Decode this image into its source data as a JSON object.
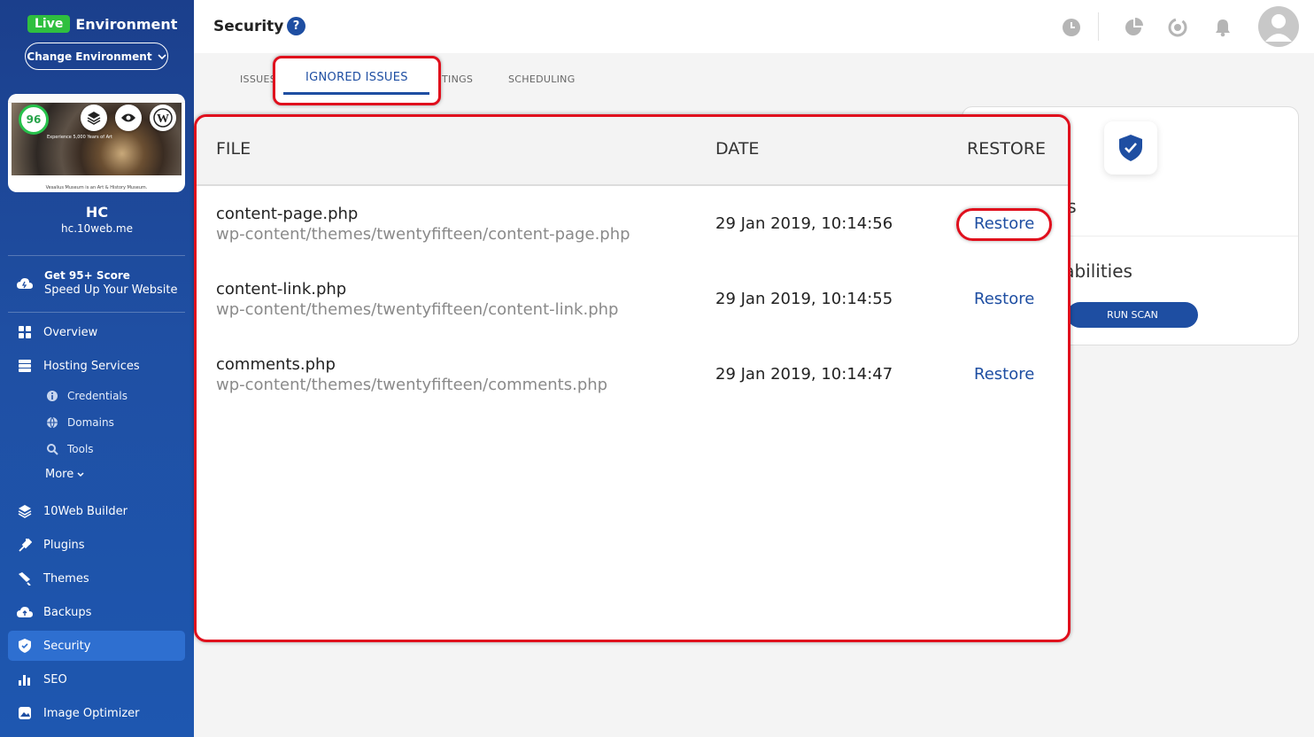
{
  "environment": {
    "badge": "Live",
    "label": "Environment",
    "change_button": "Change Environment"
  },
  "site": {
    "score": "96",
    "name": "HC",
    "url": "hc.10web.me",
    "thumb_text": "Experience 5,000 Years of Art",
    "caption": "Vesalius Museum is an Art & History Museum."
  },
  "promo": {
    "line1": "Get 95+ Score",
    "line2": "Speed Up Your Website"
  },
  "nav": {
    "overview": "Overview",
    "hosting": "Hosting Services",
    "credentials": "Credentials",
    "domains": "Domains",
    "tools": "Tools",
    "more": "More",
    "builder": "10Web Builder",
    "plugins": "Plugins",
    "themes": "Themes",
    "backups": "Backups",
    "security": "Security",
    "seo": "SEO",
    "image_optimizer": "Image Optimizer"
  },
  "header": {
    "title": "Security",
    "help": "?"
  },
  "tabs": {
    "issues": "ISSUES",
    "ignored": "IGNORED ISSUES",
    "settings": "TINGS",
    "scheduling": "SCHEDULING"
  },
  "scan_card": {
    "text1": "es",
    "text2": "rabilities",
    "button": "RUN SCAN"
  },
  "table": {
    "headers": {
      "file": "FILE",
      "date": "DATE",
      "restore": "RESTORE"
    },
    "rows": [
      {
        "file": "content-page.php",
        "path": "wp-content/themes/twentyfifteen/content-page.php",
        "date": "29 Jan 2019, 10:14:56",
        "action": "Restore"
      },
      {
        "file": "content-link.php",
        "path": "wp-content/themes/twentyfifteen/content-link.php",
        "date": "29 Jan 2019, 10:14:55",
        "action": "Restore"
      },
      {
        "file": "comments.php",
        "path": "wp-content/themes/twentyfifteen/comments.php",
        "date": "29 Jan 2019, 10:14:47",
        "action": "Restore"
      }
    ]
  },
  "colors": {
    "brand": "#1e4ea2",
    "highlight": "#e00f1d",
    "live": "#2fbf3f",
    "score": "#27c24c"
  }
}
